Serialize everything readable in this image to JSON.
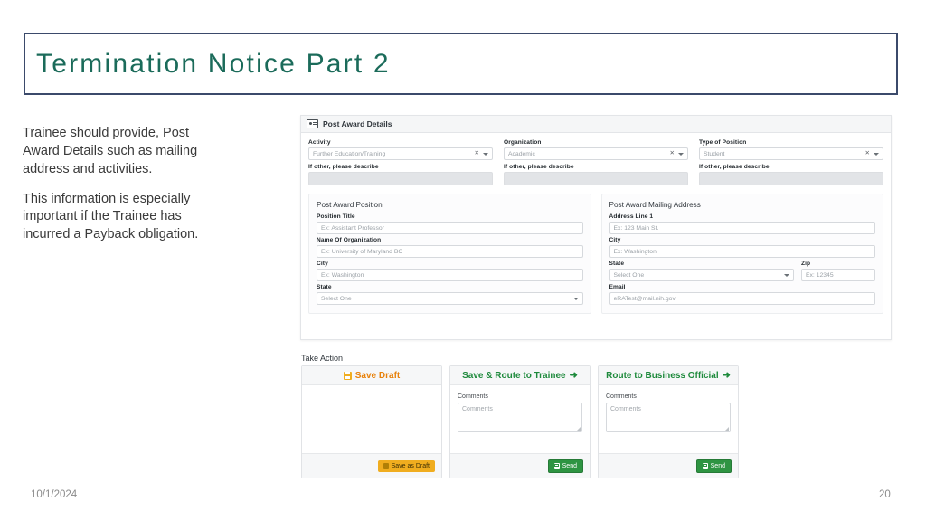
{
  "slide": {
    "title": "Termination Notice Part 2",
    "narrative": [
      "Trainee should provide, Post Award Details such as mailing address and activities.",
      "This information is especially important if the Trainee has incurred a Payback obligation."
    ],
    "footer_date": "10/1/2024",
    "page_number": "20"
  },
  "colors": {
    "title_text": "#1b6b5a",
    "title_border": "#3b4a6b",
    "draft_orange": "#e8820c",
    "route_green": "#1e8a3c",
    "send_green": "#2e9442",
    "draft_yellow": "#f0ad1f"
  },
  "app": {
    "panel_title": "Post Award Details",
    "panel_icon": "id-card-icon",
    "top_fields": [
      {
        "label": "Activity",
        "value": "Further Education/Training",
        "other_label": "If other, please describe",
        "other_value": "",
        "clear_icon": "clear-x-icon",
        "dropdown_icon": "chevron-down-icon"
      },
      {
        "label": "Organization",
        "value": "Academic",
        "other_label": "If other, please describe",
        "other_value": "",
        "clear_icon": "clear-x-icon",
        "dropdown_icon": "chevron-down-icon"
      },
      {
        "label": "Type of Position",
        "value": "Student",
        "other_label": "If other, please describe",
        "other_value": "",
        "clear_icon": "clear-x-icon",
        "dropdown_icon": "chevron-down-icon"
      }
    ],
    "position_panel": {
      "title": "Post Award Position",
      "fields": [
        {
          "label": "Position Title",
          "placeholder": "Ex: Assistant Professor",
          "type": "text"
        },
        {
          "label": "Name Of Organization",
          "placeholder": "Ex: University of Maryland BC",
          "type": "text"
        },
        {
          "label": "City",
          "placeholder": "Ex: Washington",
          "type": "text"
        },
        {
          "label": "State",
          "placeholder": "Select One",
          "type": "select"
        }
      ]
    },
    "mailing_panel": {
      "title": "Post Award Mailing Address",
      "address_line_1": {
        "label": "Address Line 1",
        "placeholder": "Ex: 123 Main St."
      },
      "city": {
        "label": "City",
        "placeholder": "Ex: Washington"
      },
      "state": {
        "label": "State",
        "placeholder": "Select One"
      },
      "zip": {
        "label": "Zip",
        "placeholder": "Ex: 12345"
      },
      "email": {
        "label": "Email",
        "placeholder": "eRATest@mail.nih.gov"
      }
    },
    "take_action": {
      "label": "Take Action",
      "cards": [
        {
          "title": "Save Draft",
          "title_icon": "floppy-disk-icon",
          "has_arrow": false,
          "has_comments": false,
          "comments_label": "",
          "comments_placeholder": "",
          "button_label": "Save as Draft",
          "button_icon": "floppy-disk-icon",
          "button_style": "draft"
        },
        {
          "title": "Save & Route to Trainee",
          "title_icon": "arrow-right-icon",
          "has_arrow": true,
          "has_comments": true,
          "comments_label": "Comments",
          "comments_placeholder": "Comments",
          "button_label": "Send",
          "button_icon": "envelope-icon",
          "button_style": "send"
        },
        {
          "title": "Route to Business Official",
          "title_icon": "arrow-right-icon",
          "has_arrow": true,
          "has_comments": true,
          "comments_label": "Comments",
          "comments_placeholder": "Comments",
          "button_label": "Send",
          "button_icon": "envelope-icon",
          "button_style": "send"
        }
      ]
    }
  }
}
